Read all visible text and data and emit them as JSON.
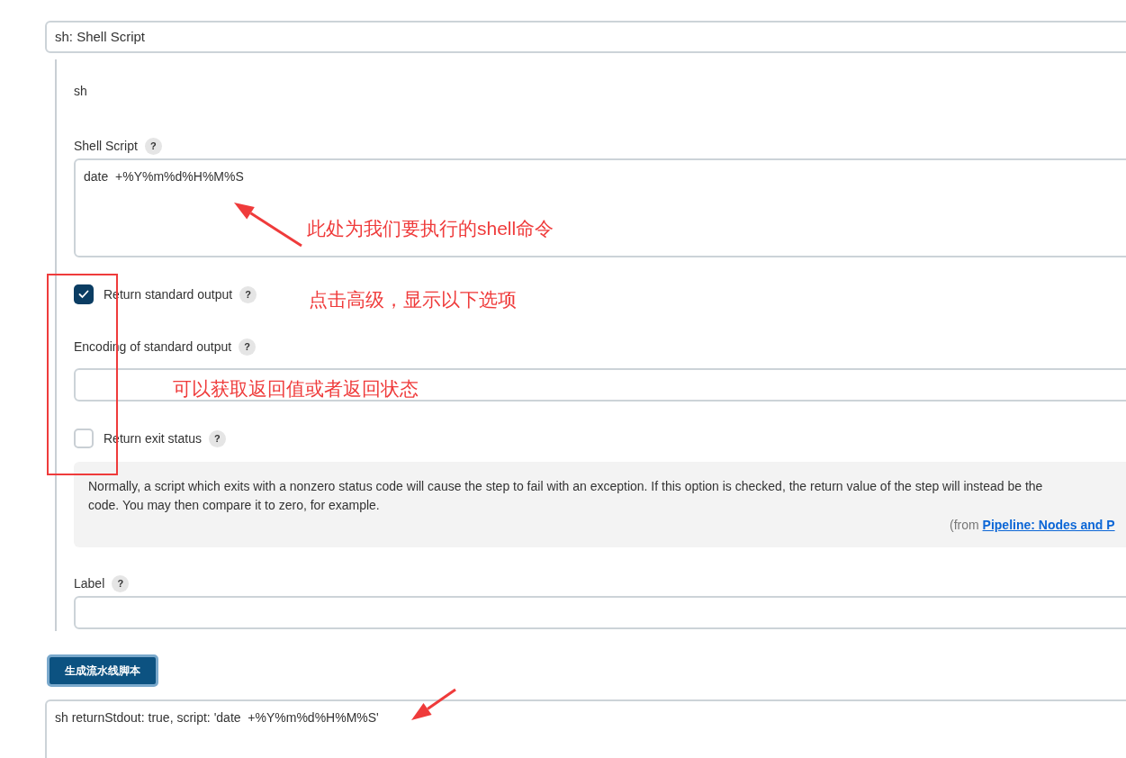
{
  "step_select": {
    "value": "sh: Shell Script"
  },
  "section_title": "sh",
  "shell_script": {
    "label": "Shell Script",
    "help": "?",
    "value": "date  +%Y%m%d%H%M%S"
  },
  "return_stdout": {
    "label": "Return standard output",
    "help": "?",
    "checked": true
  },
  "encoding": {
    "label": "Encoding of standard output",
    "help": "?"
  },
  "return_status": {
    "label": "Return exit status",
    "help": "?",
    "checked": false
  },
  "help_box": {
    "lines": [
      "Normally, a script which exits with a nonzero status code will cause the step to fail with an exception. If this option is checked, the return value of the step will instead be the",
      "code. You may then compare it to zero, for example."
    ],
    "from_prefix": "(from ",
    "from_link": "Pipeline: Nodes and P"
  },
  "label_field": {
    "label": "Label",
    "help": "?"
  },
  "generate_button": "生成流水线脚本",
  "output": {
    "value": "sh returnStdout: true, script: 'date  +%Y%m%d%H%M%S'"
  },
  "annotations": [
    {
      "text": "此处为我们要执行的shell命令"
    },
    {
      "text": "点击高级，显示以下选项"
    },
    {
      "text": "可以获取返回值或者返回状态"
    }
  ]
}
